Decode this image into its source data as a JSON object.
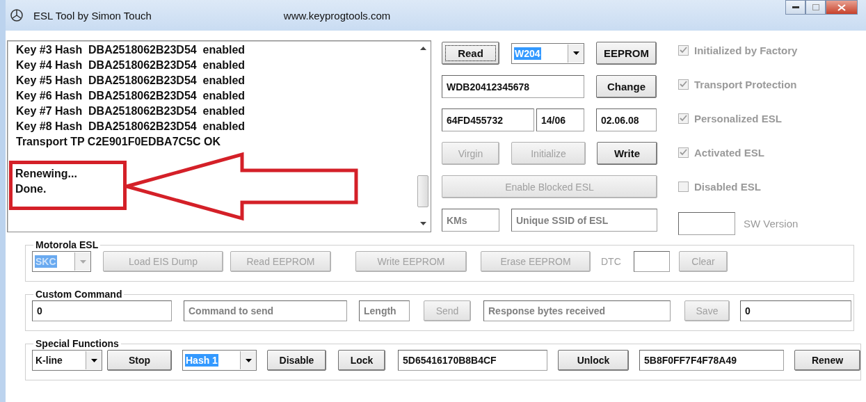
{
  "window": {
    "title": "ESL Tool by Simon Touch",
    "url": "www.keyprogtools.com"
  },
  "log": {
    "lines": [
      "Key #3 Hash  DBA2518062B23D54  enabled",
      "Key #4 Hash  DBA2518062B23D54  enabled",
      "Key #5 Hash  DBA2518062B23D54  enabled",
      "Key #6 Hash  DBA2518062B23D54  enabled",
      "Key #7 Hash  DBA2518062B23D54  enabled",
      "Key #8 Hash  DBA2518062B23D54  enabled",
      "Transport TP C2E901F0EDBA7C5C OK"
    ],
    "highlighted_lines": [
      "Renewing...",
      "Done."
    ]
  },
  "controls": [
    [
      {
        "kind": "button",
        "label": "Read",
        "disabled": false,
        "focused": true
      },
      {
        "kind": "select",
        "value": "W204",
        "highlighted": true,
        "disabled": false
      },
      {
        "kind": "button",
        "label": "EEPROM",
        "disabled": false,
        "focused": false
      }
    ],
    [
      {
        "kind": "field",
        "value": "WDB20412345678"
      },
      {
        "kind": "button",
        "label": "Change",
        "disabled": false,
        "focused": false
      }
    ],
    [
      {
        "kind": "field",
        "value": "64FD455732"
      },
      {
        "kind": "field",
        "value": "14/06"
      },
      {
        "kind": "field",
        "value": "02.06.08"
      }
    ],
    [
      {
        "kind": "button",
        "label": "Virgin",
        "disabled": true,
        "focused": false
      },
      {
        "kind": "button",
        "label": "Initialize",
        "disabled": true,
        "focused": false
      },
      {
        "kind": "button",
        "label": "Write",
        "disabled": false,
        "focused": false
      }
    ],
    [
      {
        "kind": "button",
        "label": "Enable Blocked ESL",
        "disabled": true,
        "focused": false
      }
    ],
    [
      {
        "kind": "field",
        "placeholder": "KMs"
      },
      {
        "kind": "field",
        "placeholder": "Unique SSID of ESL"
      }
    ]
  ],
  "status_checks": [
    {
      "label": "Initialized by Factory",
      "checked": true
    },
    {
      "label": "Transport Protection",
      "checked": true
    },
    {
      "label": "Personalized ESL",
      "checked": true
    },
    {
      "label": "Activated ESL",
      "checked": true
    },
    {
      "label": "Disabled ESL",
      "checked": false
    }
  ],
  "sw_version": {
    "label": "SW Version"
  },
  "groups": [
    {
      "title": "Motorola ESL",
      "items": [
        {
          "kind": "select",
          "value": "SKC",
          "highlighted": true,
          "disabled": true
        },
        {
          "kind": "button",
          "label": "Load EIS Dump",
          "disabled": true,
          "focused": false
        },
        {
          "kind": "button",
          "label": "Read EEPROM",
          "disabled": true,
          "focused": false
        },
        {
          "kind": "button",
          "label": "Write EEPROM",
          "disabled": true,
          "focused": false
        },
        {
          "kind": "button",
          "label": "Erase EEPROM",
          "disabled": true,
          "focused": false
        },
        {
          "kind": "label",
          "label": "DTC"
        },
        {
          "kind": "field"
        },
        {
          "kind": "button",
          "label": "Clear",
          "disabled": true,
          "focused": false
        }
      ]
    },
    {
      "title": "Custom Command",
      "items": [
        {
          "kind": "field",
          "value": "0"
        },
        {
          "kind": "field",
          "placeholder": "Command to send"
        },
        {
          "kind": "field",
          "placeholder": "Length"
        },
        {
          "kind": "button",
          "label": "Send",
          "disabled": true,
          "focused": false
        },
        {
          "kind": "field",
          "placeholder": "Response bytes received"
        },
        {
          "kind": "button",
          "label": "Save",
          "disabled": true,
          "focused": false
        },
        {
          "kind": "field",
          "value": "0"
        }
      ]
    },
    {
      "title": "Special Functions",
      "items": [
        {
          "kind": "select",
          "value": "K-line",
          "highlighted": false,
          "disabled": false
        },
        {
          "kind": "button",
          "label": "Stop",
          "disabled": false,
          "focused": false
        },
        {
          "kind": "select",
          "value": "Hash 1",
          "highlighted": true,
          "disabled": false
        },
        {
          "kind": "button",
          "label": "Disable",
          "disabled": false,
          "focused": false
        },
        {
          "kind": "button",
          "label": "Lock",
          "disabled": false,
          "focused": false
        },
        {
          "kind": "field",
          "value": "5D65416170B8B4CF"
        },
        {
          "kind": "button",
          "label": "Unlock",
          "disabled": false,
          "focused": false
        },
        {
          "kind": "field",
          "value": "5B8F0FF7F4F78A49"
        },
        {
          "kind": "button",
          "label": "Renew",
          "disabled": false,
          "focused": false
        }
      ]
    }
  ]
}
